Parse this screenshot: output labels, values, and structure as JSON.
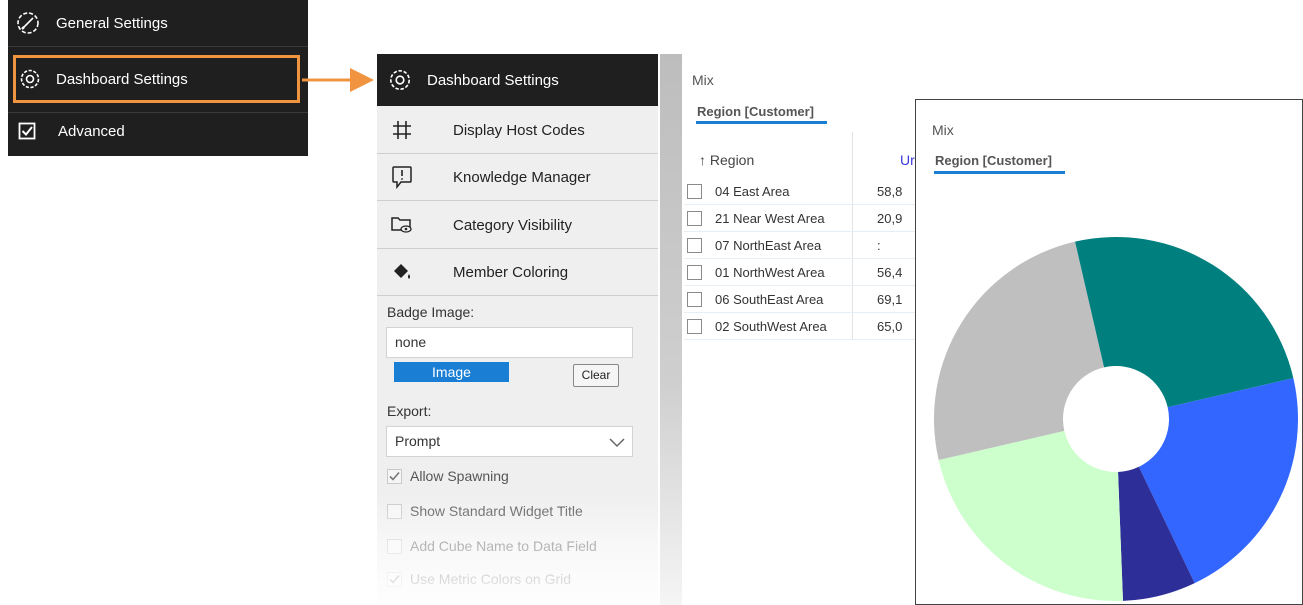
{
  "main_menu": {
    "general_settings": "General Settings",
    "dashboard_settings": "Dashboard Settings",
    "advanced": "Advanced"
  },
  "settings_panel": {
    "header": "Dashboard Settings",
    "items": [
      {
        "label": "Display Host Codes",
        "icon": "hash-icon"
      },
      {
        "label": "Knowledge Manager",
        "icon": "speech-bubble-icon"
      },
      {
        "label": "Category Visibility",
        "icon": "folder-eye-icon"
      },
      {
        "label": "Member Coloring",
        "icon": "paint-bucket-icon"
      }
    ],
    "badge_image_label": "Badge Image:",
    "badge_image_value": "none",
    "image_button": "Image",
    "clear_button": "Clear",
    "export_label": "Export:",
    "export_value": "Prompt",
    "checkboxes": [
      {
        "label": "Allow Spawning",
        "checked": true
      },
      {
        "label": "Show Standard Widget Title",
        "checked": false
      },
      {
        "label": "Add Cube Name to Data Field",
        "checked": false
      },
      {
        "label": "Use Metric Colors on Grid",
        "checked": true
      }
    ]
  },
  "mix_grid": {
    "title": "Mix",
    "tab": "Region [Customer]",
    "col_region": "↑ Region",
    "col_units": "Ur",
    "rows": [
      {
        "region": "04 East Area",
        "value": "58,8"
      },
      {
        "region": "21 Near West Area",
        "value": "20,9"
      },
      {
        "region": "07 NorthEast Area",
        "value": ":"
      },
      {
        "region": "01 NorthWest Area",
        "value": "56,4"
      },
      {
        "region": "06 SouthEast Area",
        "value": "69,1"
      },
      {
        "region": "02 SouthWest Area",
        "value": "65,0"
      }
    ]
  },
  "mix_chart": {
    "title": "Mix",
    "tab": "Region [Customer]"
  },
  "chart_data": {
    "type": "pie",
    "donut": true,
    "slices": [
      {
        "value": 21.5,
        "color": "#3366ff"
      },
      {
        "value": 6.5,
        "color": "#2e2e99"
      },
      {
        "value": 22.0,
        "color": "#ccffcc"
      },
      {
        "value": 25.0,
        "color": "#bfbfbf"
      },
      {
        "value": 25.0,
        "color": "#007f7f"
      }
    ],
    "start_angle_deg": -13
  },
  "colors": {
    "menu_bg": "#1f1f1f",
    "highlight": "#f0943f",
    "accent": "#1a7ed4"
  }
}
